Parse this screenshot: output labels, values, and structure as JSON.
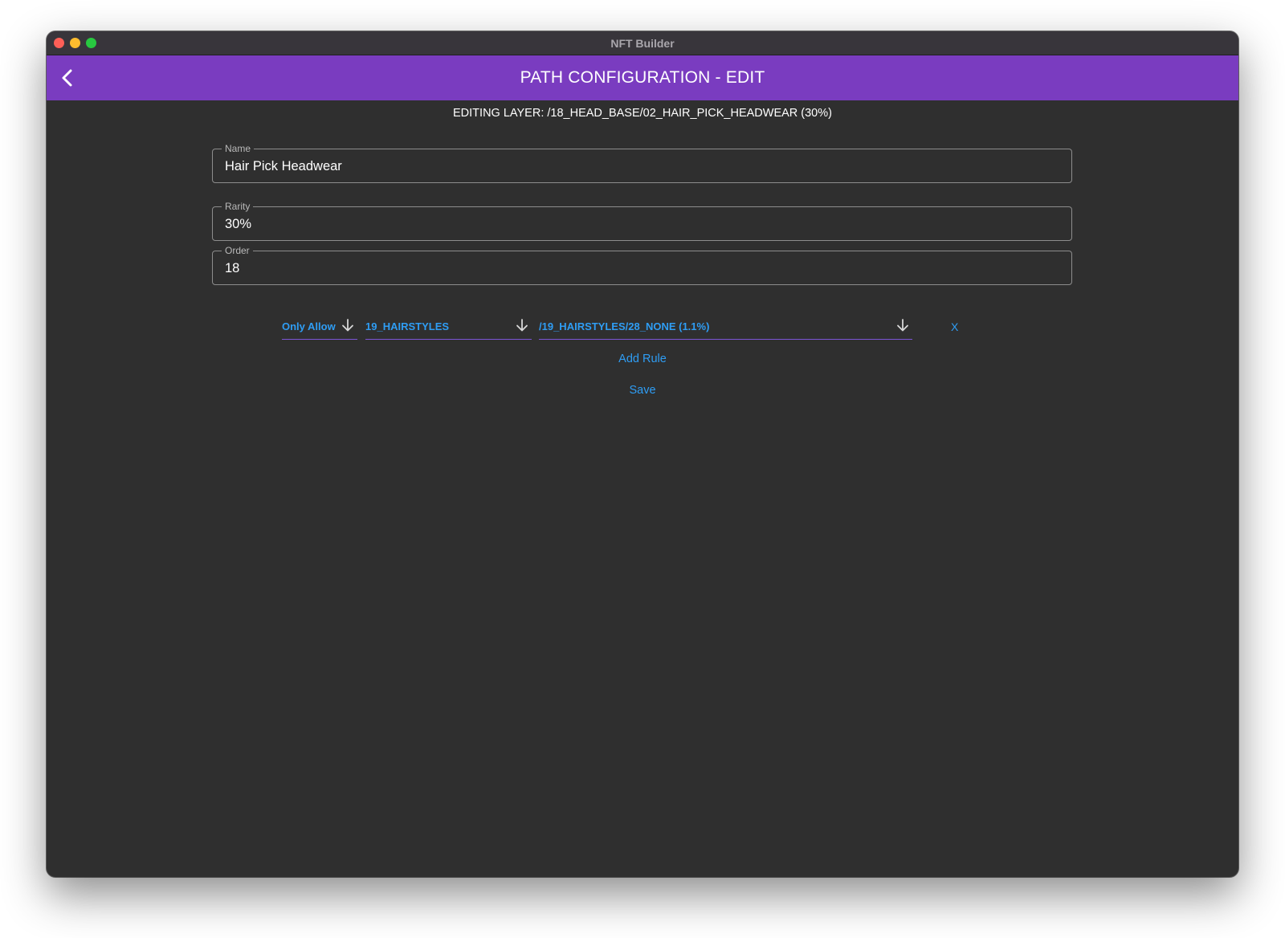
{
  "window": {
    "title": "NFT Builder"
  },
  "appbar": {
    "title": "PATH CONFIGURATION - EDIT",
    "back_icon": "chevron-left-icon"
  },
  "layer_info": "EDITING LAYER: /18_HEAD_BASE/02_HAIR_PICK_HEADWEAR (30%)",
  "form": {
    "name": {
      "label": "Name",
      "value": "Hair Pick Headwear"
    },
    "rarity": {
      "label": "Rarity",
      "value": "30%"
    },
    "order": {
      "label": "Order",
      "value": "18"
    }
  },
  "rules": [
    {
      "type": "Only Allow",
      "layer": "19_HAIRSTYLES",
      "path": "/19_HAIRSTYLES/28_NONE (1.1%)",
      "remove_label": "X"
    }
  ],
  "actions": {
    "add_rule": "Add Rule",
    "save": "Save"
  },
  "colors": {
    "appbar": "#7a3cc0",
    "background": "#2f2f2f",
    "link": "#2f9df4",
    "dropdown_underline": "#7c55d6"
  }
}
